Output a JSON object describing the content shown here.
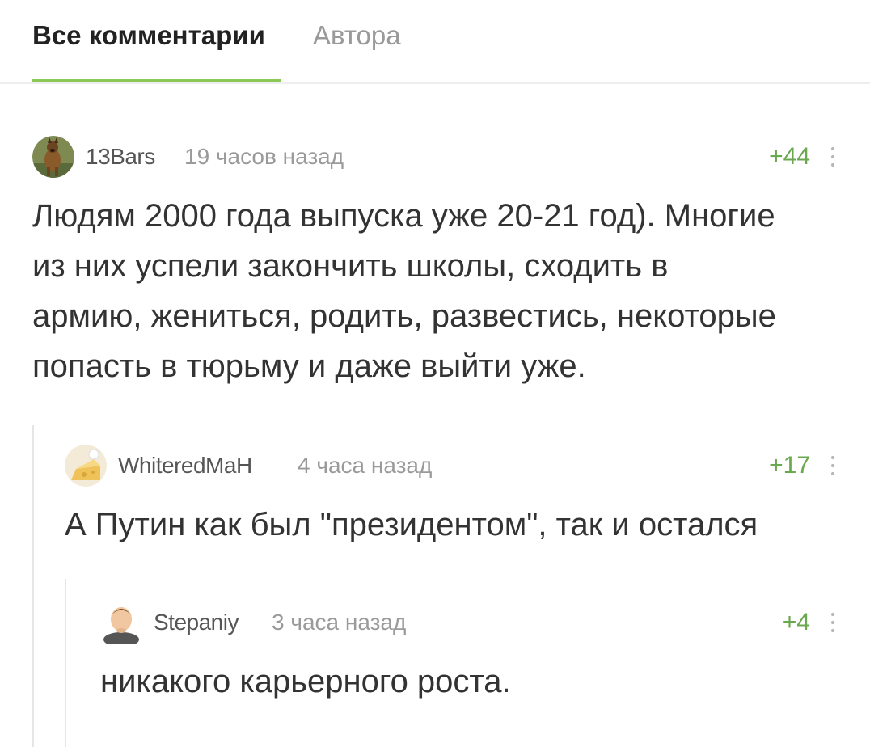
{
  "tabs": {
    "all": "Все комментарии",
    "author": "Автора"
  },
  "comments": [
    {
      "author": "13Bars",
      "time": "19 часов назад",
      "rating": "+44",
      "text_lines": [
        "Людям  2000 года выпуска уже 20-21 год). Многие",
        "из них успели  закончить школы, сходить в",
        "армию, жениться, родить, развестись, некоторые",
        "попасть в тюрьму и даже выйти уже."
      ]
    },
    {
      "author": "WhiteredMaH",
      "time": "4 часа назад",
      "rating": "+17",
      "text_lines": [
        "А Путин как был \"президентом\", так и остался"
      ]
    },
    {
      "author": "Stepaniy",
      "time": "3 часа назад",
      "rating": "+4",
      "text_lines": [
        "никакого карьерного роста."
      ]
    }
  ],
  "colors": {
    "accent": "#8ac858",
    "rating": "#6aa84f",
    "muted": "#9a9a9a",
    "text": "#333333"
  }
}
